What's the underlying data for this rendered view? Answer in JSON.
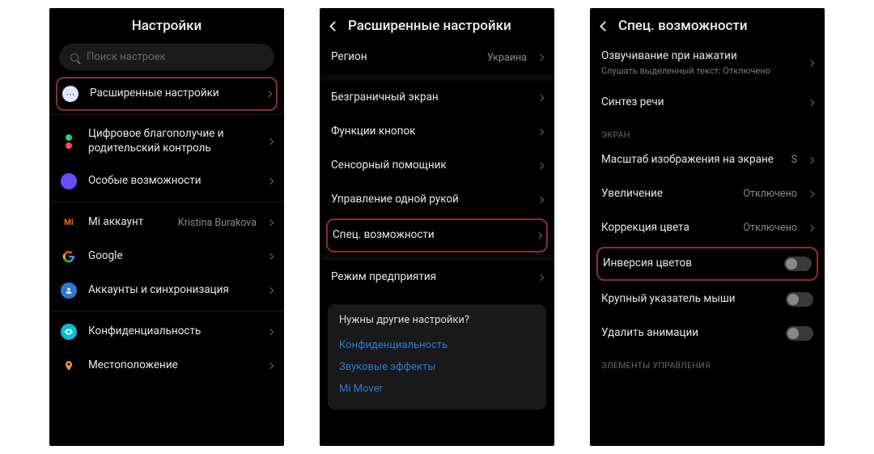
{
  "panel1": {
    "title": "Настройки",
    "search_placeholder": "Поиск настроек",
    "advanced": "Расширенные настройки",
    "wellbeing": "Цифровое благополучие и родительский контроль",
    "special": "Особые возможности",
    "mi_account_label": "Mi аккаунт",
    "mi_account_value": "Kristina Burakova",
    "google": "Google",
    "accounts_sync": "Аккаунты и синхронизация",
    "privacy": "Конфиденциальность",
    "location": "Местоположение"
  },
  "panel2": {
    "title": "Расширенные настройки",
    "region_label": "Регион",
    "region_value": "Украина",
    "fullscreen": "Безграничный экран",
    "button_functions": "Функции кнопок",
    "touch_assistant": "Сенсорный помощник",
    "one_hand": "Управление одной рукой",
    "accessibility": "Спец. возможности",
    "enterprise": "Режим предприятия",
    "footer_heading": "Нужны другие настройки?",
    "footer_link1": "Конфиденциальность",
    "footer_link2": "Звуковые эффекты",
    "footer_link3": "Mi Mover"
  },
  "panel3": {
    "title": "Спец. возможности",
    "tap_speak_label": "Озвучивание при нажатии",
    "tap_speak_sub": "Слушать выделенный текст: Отключено",
    "tts": "Синтез речи",
    "section_screen": "ЭКРАН",
    "display_scale_label": "Масштаб изображения на экране",
    "display_scale_value": "S",
    "zoom_label": "Увеличение",
    "zoom_value": "Отключено",
    "color_corr_label": "Коррекция цвета",
    "color_corr_value": "Отключено",
    "inversion": "Инверсия цветов",
    "large_pointer": "Крупный указатель мыши",
    "remove_anim": "Удалить анимации",
    "section_controls": "ЭЛЕМЕНТЫ УПРАВЛЕНИЯ"
  }
}
